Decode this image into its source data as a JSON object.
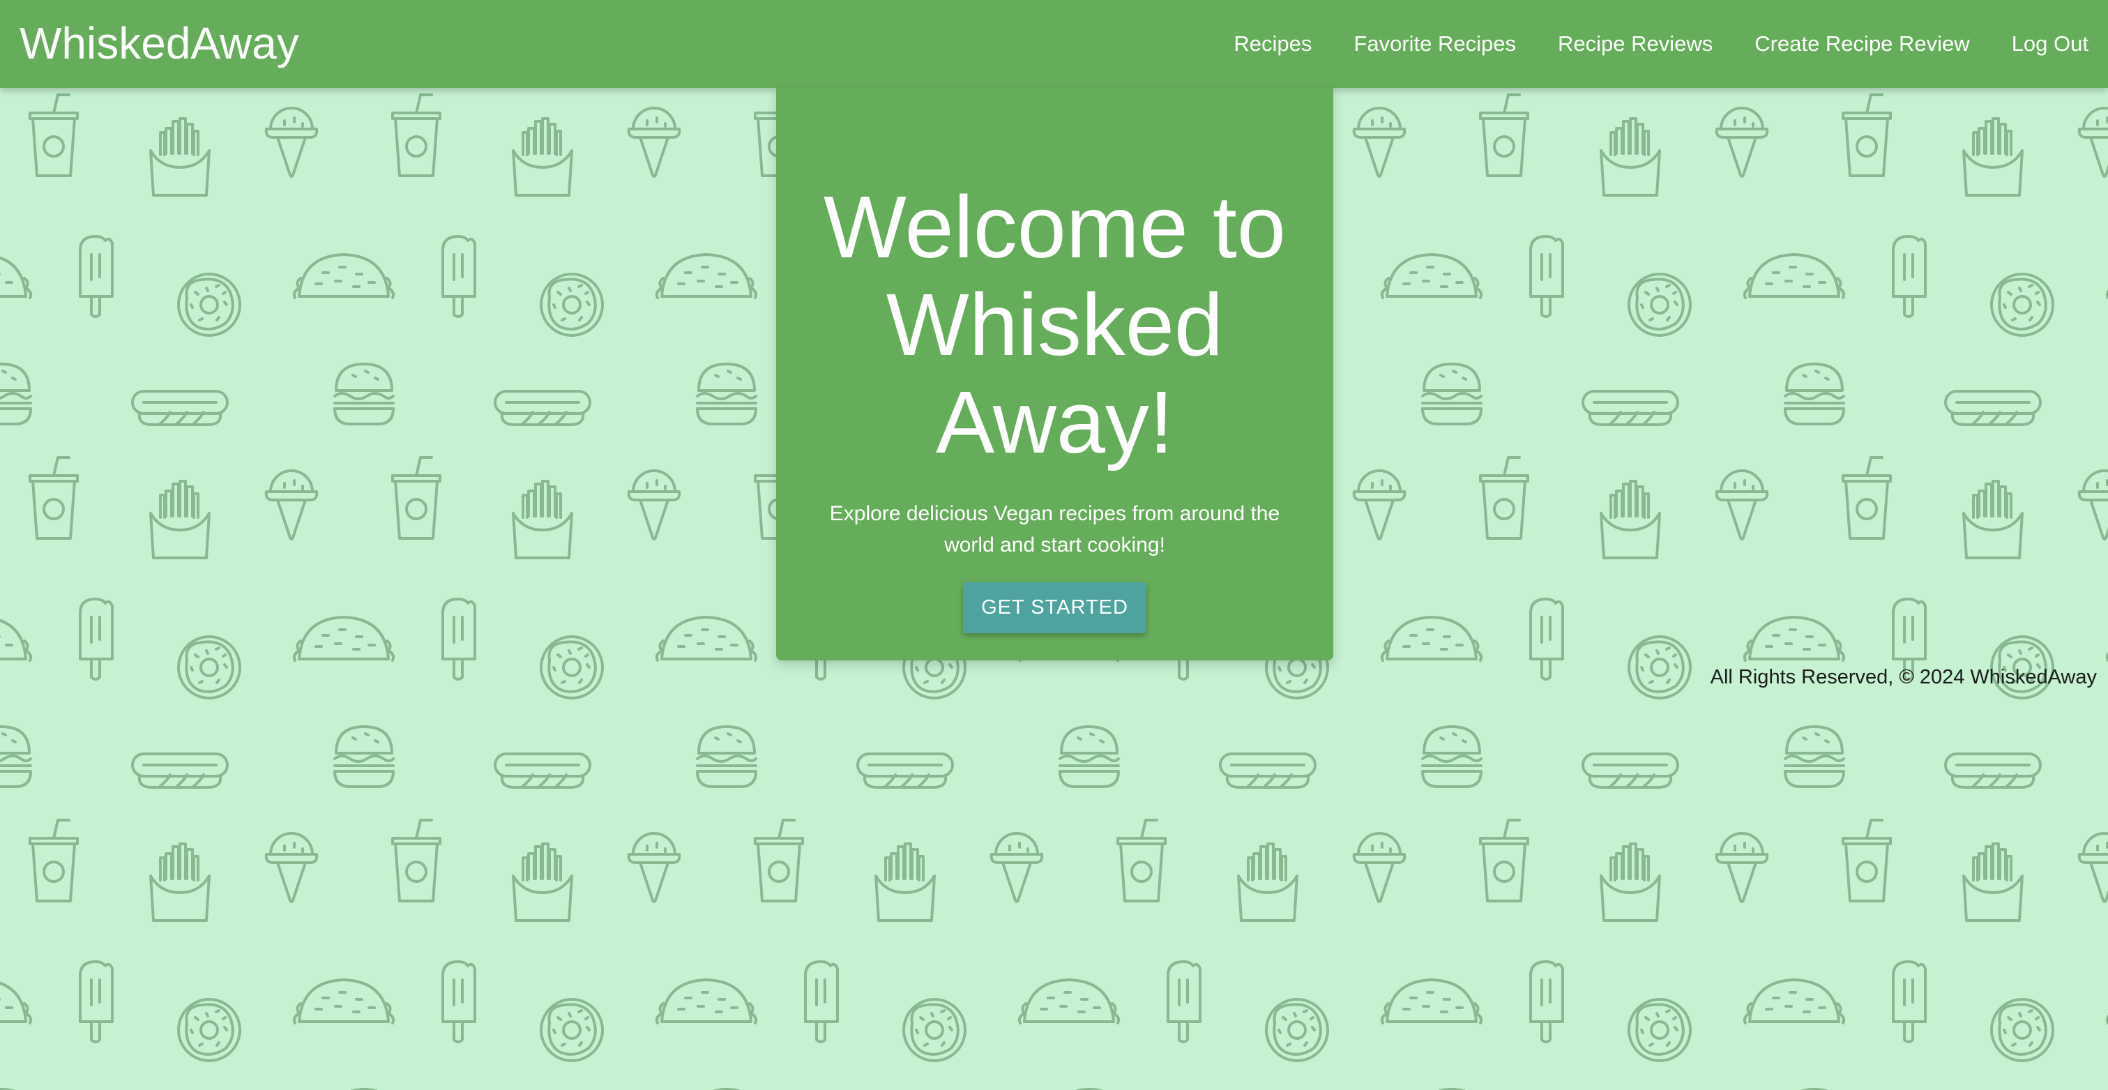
{
  "navbar": {
    "brand": "WhiskedAway",
    "links": [
      "Recipes",
      "Favorite Recipes",
      "Recipe Reviews",
      "Create Recipe Review",
      "Log Out"
    ]
  },
  "hero": {
    "title": "Welcome to Whisked Away!",
    "subtitle": "Explore delicious Vegan recipes from around the world and start cooking!",
    "cta_label": "GET STARTED"
  },
  "footer": {
    "text": "All Rights Reserved, © 2024 WhiskedAway"
  },
  "colors": {
    "background": "#c6f2d2",
    "navbar": "#66ad5b",
    "hero_card": "#66ad5b",
    "button": "#4ea39e",
    "pattern_stroke": "#88b991"
  },
  "background_pattern_icons": [
    "drink-cup-icon",
    "french-fries-icon",
    "ice-cream-cone-icon",
    "popsicle-icon",
    "donut-icon",
    "taco-icon",
    "hot-dog-icon",
    "burger-icon"
  ]
}
